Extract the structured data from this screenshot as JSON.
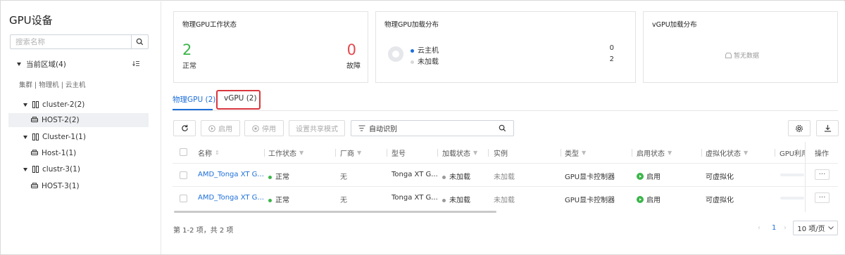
{
  "sidebar": {
    "title": "GPU设备",
    "search_placeholder": "搜索名称",
    "region": "当前区域(4)",
    "path": "集群 | 物理机 | 云主机",
    "tree": {
      "c1": "cluster-2(2)",
      "h1": "HOST-2(2)",
      "c2": "Cluster-1(1)",
      "h2": "Host-1(1)",
      "c3": "clustr-3(1)",
      "h3": "HOST-3(1)"
    }
  },
  "cards": {
    "status": {
      "title": "物理GPU工作状态",
      "normal_count": "2",
      "normal_label": "正常",
      "fault_count": "0",
      "fault_label": "故障"
    },
    "load": {
      "title": "物理GPU加载分布",
      "items": [
        {
          "label": "云主机",
          "value": "0"
        },
        {
          "label": "未加载",
          "value": "2"
        }
      ]
    },
    "vgpu": {
      "title": "vGPU加载分布",
      "empty": "暂无数据"
    }
  },
  "tabs": [
    {
      "label": "物理GPU (2)"
    },
    {
      "label": "vGPU  (2)"
    }
  ],
  "toolbar": {
    "start": "启用",
    "stop": "停用",
    "share": "设置共享模式",
    "filter": "自动识别"
  },
  "table": {
    "headers": [
      "名称",
      "工作状态",
      "厂商",
      "型号",
      "加载状态",
      "实例",
      "类型",
      "启用状态",
      "虚拟化状态",
      "GPU利用",
      "操作"
    ],
    "rows": [
      {
        "name": "AMD_Tonga XT G...",
        "status": "正常",
        "vendor": "无",
        "model": "Tonga XT G...",
        "load": "未加载",
        "instance": "未加载",
        "type": "GPU显卡控制器",
        "enabled": "启用",
        "virt": "可虚拟化",
        "actions": "···"
      },
      {
        "name": "AMD_Tonga XT G...",
        "status": "正常",
        "vendor": "无",
        "model": "Tonga XT G...",
        "load": "未加载",
        "instance": "未加载",
        "type": "GPU显卡控制器",
        "enabled": "启用",
        "virt": "可虚拟化",
        "actions": "···"
      }
    ]
  },
  "pagination": {
    "summary": "第 1-2 项，共 2 项",
    "page": "1",
    "page_size": "10 项/页"
  },
  "colors": {
    "accent": "#1e6fd9",
    "success": "#3bb54a",
    "danger": "#e5484d",
    "highlight_border": "#d9363e",
    "muted_dot": "#9a9a9a"
  }
}
